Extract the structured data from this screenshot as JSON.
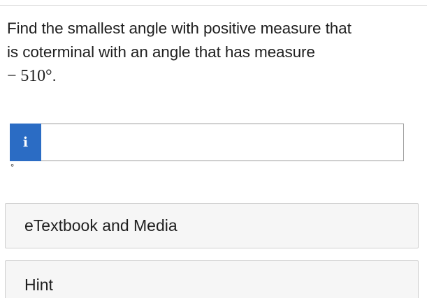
{
  "question": {
    "line1": "Find the smallest angle with positive measure that",
    "line2": "is coterminal with an angle that has measure",
    "math_expression": "− 510°",
    "trailing_period": "."
  },
  "answer": {
    "info_glyph": "i",
    "input_value": "",
    "unit": "°"
  },
  "resources": {
    "etextbook_label": "eTextbook and Media",
    "hint_label": "Hint"
  },
  "colors": {
    "accent": "#2b6cc4",
    "input_border": "#9b9b9b",
    "button_bg": "#f6f6f6"
  },
  "icons": {
    "info": "info-icon"
  }
}
